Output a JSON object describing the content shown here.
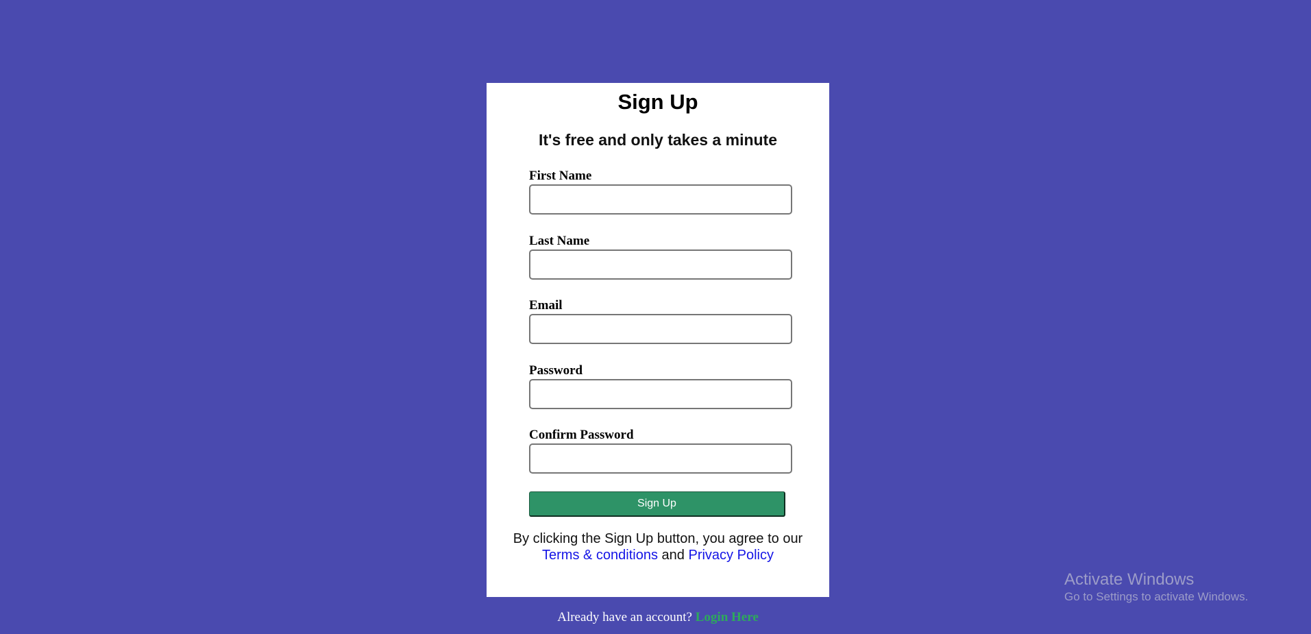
{
  "signup": {
    "title": "Sign Up",
    "subtitle": "It's free and only takes a minute",
    "fields": [
      {
        "label": "First Name",
        "value": ""
      },
      {
        "label": "Last Name",
        "value": ""
      },
      {
        "label": "Email",
        "value": ""
      },
      {
        "label": "Password",
        "value": ""
      },
      {
        "label": "Confirm Password",
        "value": ""
      }
    ],
    "submit_label": "Sign Up",
    "agreement": {
      "text_before": "By clicking the Sign Up button, you agree to our",
      "terms_link": "Terms & conditions",
      "conjunction": "and",
      "privacy_link": "Privacy Policy"
    }
  },
  "footer": {
    "text": "Already have an account?",
    "login_link": "Login Here"
  },
  "watermark": {
    "title": "Activate Windows",
    "subtitle": "Go to Settings to activate Windows."
  },
  "colors": {
    "background": "#4a4aaf",
    "card": "#ffffff",
    "button": "#2e9367",
    "link": "#1414e6",
    "login_link": "#2eaa5c"
  }
}
